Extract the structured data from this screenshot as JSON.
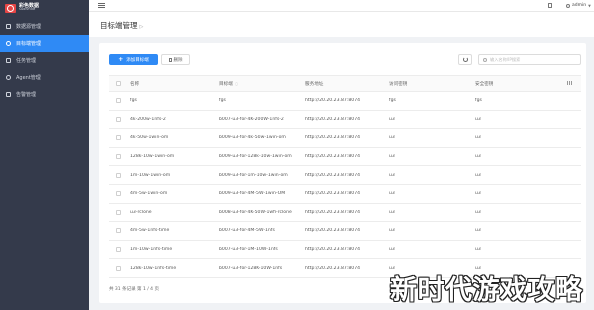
{
  "brand": {
    "name": "彩色数据",
    "sub": "SANDSTONE"
  },
  "sidebar": {
    "items": [
      {
        "label": "数据源管理",
        "icon": "database-icon",
        "active": false
      },
      {
        "label": "目标端管理",
        "icon": "target-icon",
        "active": true
      },
      {
        "label": "任务管理",
        "icon": "task-icon",
        "active": false
      },
      {
        "label": "Agent管理",
        "icon": "agent-icon",
        "active": false
      },
      {
        "label": "告警管理",
        "icon": "alarm-icon",
        "active": false
      }
    ]
  },
  "topbar": {
    "user": "admin"
  },
  "page": {
    "title": "目标端管理"
  },
  "toolbar": {
    "add_label": "添加目标端",
    "delete_label": "删除",
    "search_placeholder": "输入名称/IP搜索"
  },
  "table": {
    "headers": [
      "名称",
      "目标端",
      "服务地址",
      "访问密钥",
      "安全密钥"
    ],
    "rows": [
      [
        "fgs",
        "fgs",
        "http://20.20.23.87:8074",
        "fgs",
        "fgs"
      ],
      [
        "4k-200w-1nfs-2",
        "b007-u3-for-4K-200W-1nfs-2",
        "http://20.20.23.87:8074",
        "u3",
        "u3"
      ],
      [
        "4k-50w-1win-om",
        "b009-u3-for-4k-50w-1win-om",
        "http://20.20.23.87:8074",
        "u3",
        "u3"
      ],
      [
        "128k-10w-1win-om",
        "b009-u3-for-128k-10w-1win-om",
        "http://20.20.23.87:8074",
        "u3",
        "u3"
      ],
      [
        "1m-10w-1win-om",
        "b009-u3-for-1m-10w-1win-om",
        "http://20.20.23.87:8074",
        "u3",
        "u3"
      ],
      [
        "4m-5w-1win-om",
        "b009-u3-for-4M-5W-1win-OM",
        "http://20.20.23.87:8074",
        "u3",
        "u3"
      ],
      [
        "u3-rclone",
        "b008-u3-for-4K-50W-1wfi-rclone",
        "http://20.20.23.87:8074",
        "u3",
        "u3"
      ],
      [
        "4m-5w-1nfs-time",
        "b007-u3-for-4M-5W-1nfs",
        "http://20.20.23.87:8074",
        "u3",
        "u3"
      ],
      [
        "1m-10w-1nfs-time",
        "b007-u3-for-1M-10W-1nfs",
        "http://20.20.23.87:8074",
        "u3",
        "u3"
      ],
      [
        "128k-10w-1nfs-time",
        "b007-u3-for-128K-10W-1nfs",
        "http://20.20.23.87:8074",
        "u3",
        "u3"
      ]
    ]
  },
  "pagination": {
    "summary": "共 31 条记录  第 1 / 4 页"
  },
  "watermark": "新时代游戏攻略"
}
